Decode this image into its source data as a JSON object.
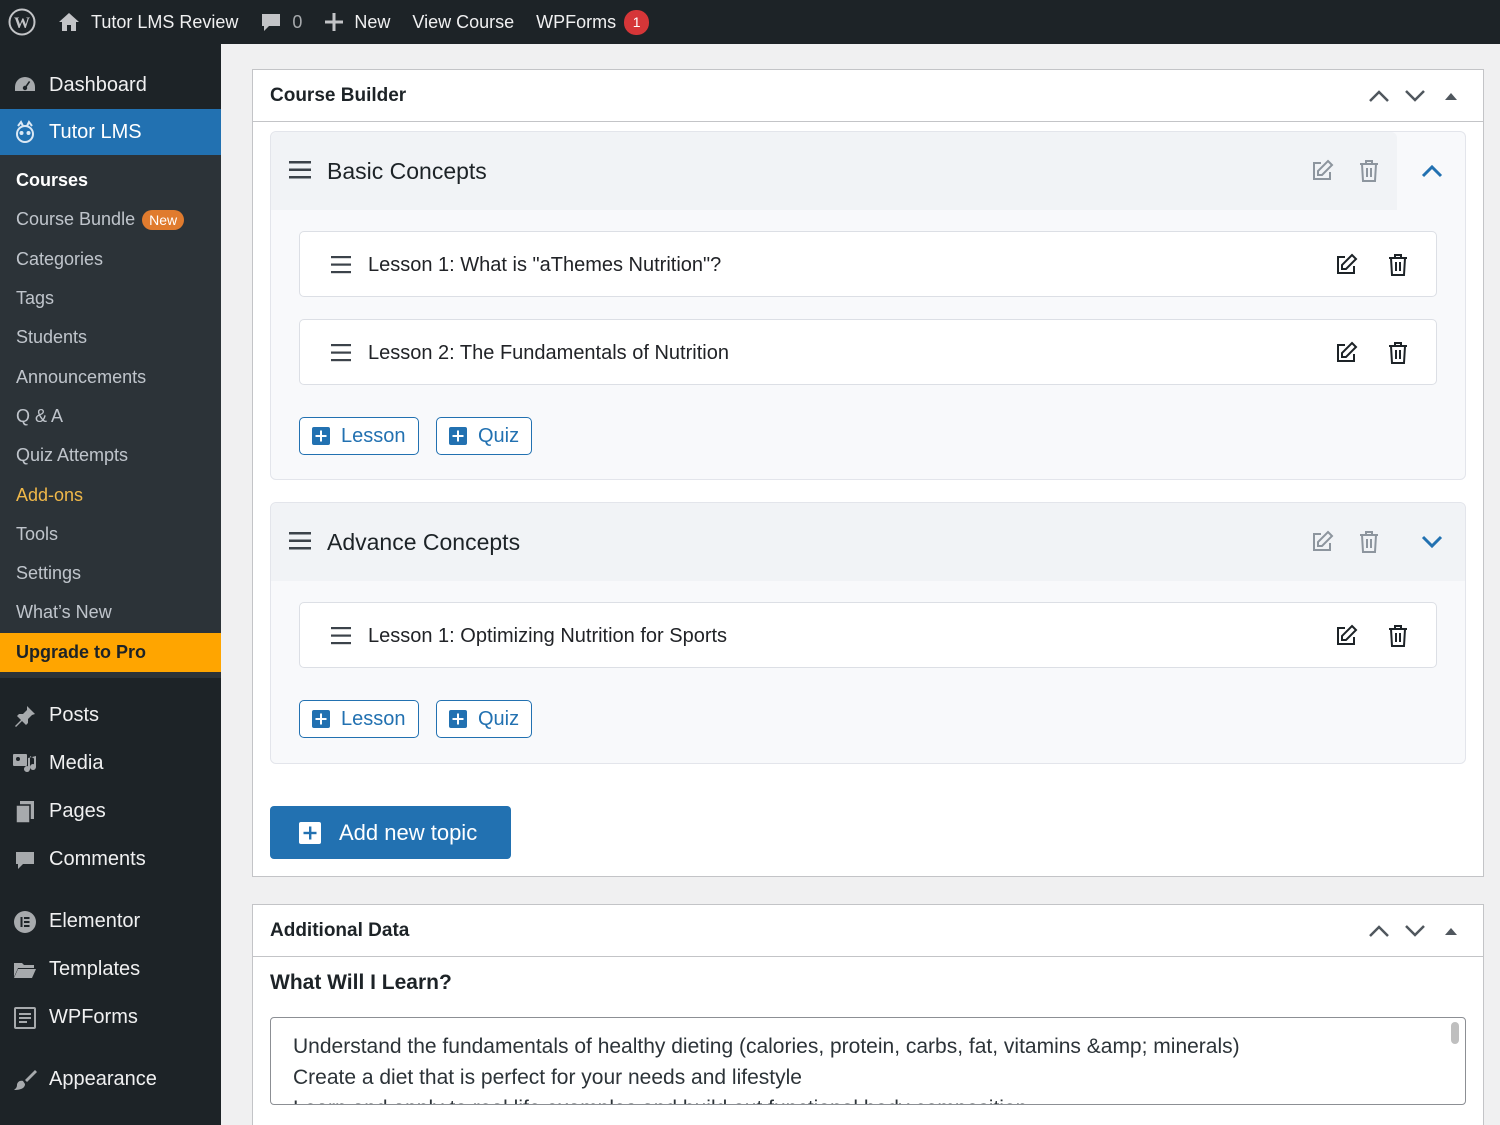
{
  "adminbar": {
    "site_name": "Tutor LMS Review",
    "comments_count": "0",
    "new_label": "New",
    "view_course": "View Course",
    "wpforms": "WPForms",
    "wpforms_badge": "1"
  },
  "sidebar": {
    "dashboard": "Dashboard",
    "tutor_lms": "Tutor LMS",
    "submenu": [
      {
        "label": "Courses"
      },
      {
        "label": "Course Bundle",
        "badge": "New"
      },
      {
        "label": "Categories"
      },
      {
        "label": "Tags"
      },
      {
        "label": "Students"
      },
      {
        "label": "Announcements"
      },
      {
        "label": "Q & A"
      },
      {
        "label": "Quiz Attempts"
      },
      {
        "label": "Add-ons"
      },
      {
        "label": "Tools"
      },
      {
        "label": "Settings"
      },
      {
        "label": "What’s New"
      },
      {
        "label": "Upgrade to Pro"
      }
    ],
    "posts": "Posts",
    "media": "Media",
    "pages": "Pages",
    "comments": "Comments",
    "elementor": "Elementor",
    "templates": "Templates",
    "wpforms": "WPForms",
    "appearance": "Appearance"
  },
  "course_builder": {
    "title": "Course Builder",
    "topics": [
      {
        "title": "Basic Concepts",
        "lessons": [
          "Lesson 1: What is \"aThemes Nutrition\"?",
          "Lesson 2: The Fundamentals of Nutrition"
        ]
      },
      {
        "title": "Advance Concepts",
        "lessons": [
          "Lesson 1: Optimizing Nutrition for Sports"
        ]
      }
    ],
    "lesson_btn": "Lesson",
    "quiz_btn": "Quiz",
    "add_topic": "Add new topic"
  },
  "additional_data": {
    "title": "Additional Data",
    "learn_label": "What Will I Learn?",
    "learn_lines": [
      "Understand the fundamentals of healthy dieting (calories, protein, carbs, fat, vitamins &amp; minerals)",
      "Create a diet that is perfect for your needs and lifestyle",
      "Learn and apply to real life examples and build out functional body composition"
    ]
  },
  "colors": {
    "accent": "#2271b1",
    "adminbar": "#1d2327",
    "upgrade": "#ffa500"
  }
}
